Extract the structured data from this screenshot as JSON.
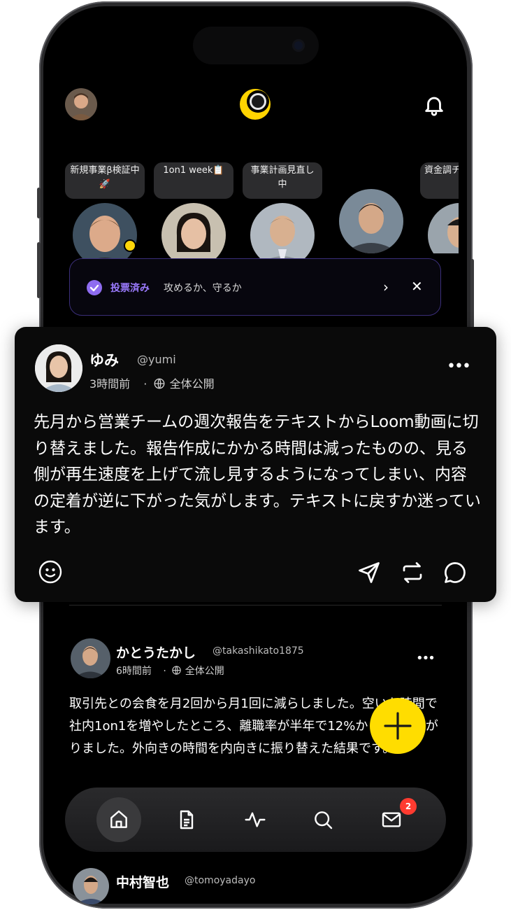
{
  "colors": {
    "accent_purple": "#9b7bff",
    "fab_yellow": "#ffdd00",
    "online_dot": "#ffd60a",
    "badge_red": "#ff3b30"
  },
  "stories": [
    {
      "caption": "新規事業β検証中🚀",
      "online": true
    },
    {
      "caption": "1on1 week📋"
    },
    {
      "caption": "事業計画見直し中"
    },
    {
      "caption": ""
    },
    {
      "caption": "資金調チ準"
    }
  ],
  "vote_banner": {
    "label": "投票済み",
    "text": "攻めるか、守るか",
    "chevron": "›",
    "close": "✕"
  },
  "focused_post": {
    "name": "ゆみ",
    "handle": "@yumi",
    "time": "3時間前",
    "visibility": "全体公開",
    "body": "先月から営業チームの週次報告をテキストからLoom動画に切り替えました。報告作成にかかる時間は減ったものの、見る側が再生速度を上げて流し見するようになってしまい、内容の定着が逆に下がった気がします。テキストに戻すか迷っています。",
    "actions": [
      "emoji-icon",
      "send-icon",
      "repost-icon",
      "comment-icon"
    ]
  },
  "post2": {
    "name": "かとうたかし",
    "handle": "@takashikato1875",
    "time": "6時間前",
    "visibility": "全体公開",
    "body": "取引先との会食を月2回から月1回に減らしました。空いた時間で社内1on1を増やしたところ、離職率が半年で12%から9%に下がりました。外向きの時間を内向きに振り替えた結果です。"
  },
  "post3": {
    "name": "中村智也",
    "handle": "@tomoyadayo"
  },
  "nav": {
    "items": [
      "home-icon",
      "document-icon",
      "activity-icon",
      "search-icon",
      "mail-icon"
    ],
    "active": "home-icon",
    "mail_badge": "2"
  }
}
